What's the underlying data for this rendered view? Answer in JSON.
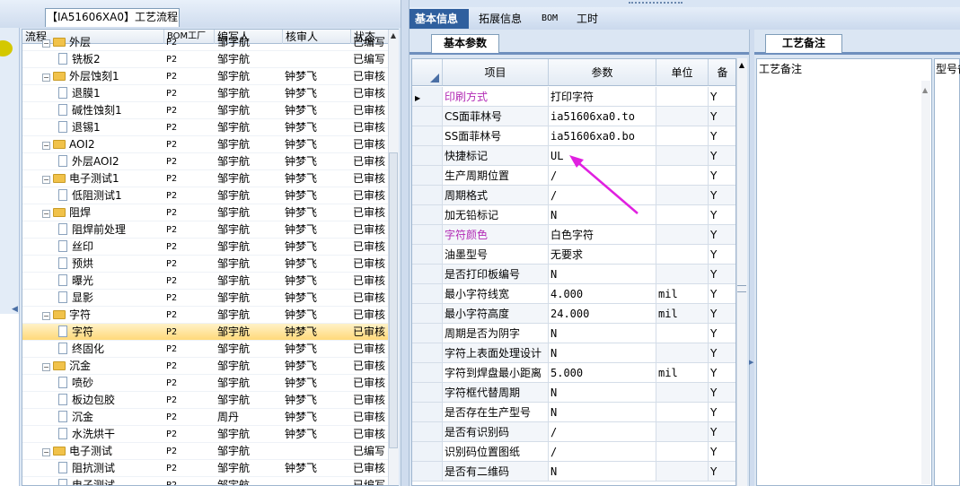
{
  "left_tab": {
    "title": "【IA51606XA0】工艺流程"
  },
  "tree": {
    "columns": [
      "流程",
      "BOM工厂",
      "编写人",
      "核审人",
      "状态"
    ],
    "rows": [
      {
        "level": 1,
        "type": "folder",
        "name": "外层",
        "factory": "P2",
        "writer": "邹宇航",
        "reviewer": "",
        "status": "已编写"
      },
      {
        "level": 2,
        "type": "doc",
        "name": "铣板2",
        "factory": "P2",
        "writer": "邹宇航",
        "reviewer": "",
        "status": "已编写"
      },
      {
        "level": 1,
        "type": "folder",
        "name": "外层蚀刻1",
        "factory": "P2",
        "writer": "邹宇航",
        "reviewer": "钟梦飞",
        "status": "已审核"
      },
      {
        "level": 2,
        "type": "doc",
        "name": "退膜1",
        "factory": "P2",
        "writer": "邹宇航",
        "reviewer": "钟梦飞",
        "status": "已审核"
      },
      {
        "level": 2,
        "type": "doc",
        "name": "碱性蚀刻1",
        "factory": "P2",
        "writer": "邹宇航",
        "reviewer": "钟梦飞",
        "status": "已审核"
      },
      {
        "level": 2,
        "type": "doc",
        "name": "退锡1",
        "factory": "P2",
        "writer": "邹宇航",
        "reviewer": "钟梦飞",
        "status": "已审核"
      },
      {
        "level": 1,
        "type": "folder",
        "name": "AOI2",
        "factory": "P2",
        "writer": "邹宇航",
        "reviewer": "钟梦飞",
        "status": "已审核"
      },
      {
        "level": 2,
        "type": "doc",
        "name": "外层AOI2",
        "factory": "P2",
        "writer": "邹宇航",
        "reviewer": "钟梦飞",
        "status": "已审核"
      },
      {
        "level": 1,
        "type": "folder",
        "name": "电子测试1",
        "factory": "P2",
        "writer": "邹宇航",
        "reviewer": "钟梦飞",
        "status": "已审核"
      },
      {
        "level": 2,
        "type": "doc",
        "name": "低阻测试1",
        "factory": "P2",
        "writer": "邹宇航",
        "reviewer": "钟梦飞",
        "status": "已审核"
      },
      {
        "level": 1,
        "type": "folder",
        "name": "阻焊",
        "factory": "P2",
        "writer": "邹宇航",
        "reviewer": "钟梦飞",
        "status": "已审核"
      },
      {
        "level": 2,
        "type": "doc",
        "name": "阻焊前处理",
        "factory": "P2",
        "writer": "邹宇航",
        "reviewer": "钟梦飞",
        "status": "已审核"
      },
      {
        "level": 2,
        "type": "doc",
        "name": "丝印",
        "factory": "P2",
        "writer": "邹宇航",
        "reviewer": "钟梦飞",
        "status": "已审核"
      },
      {
        "level": 2,
        "type": "doc",
        "name": "预烘",
        "factory": "P2",
        "writer": "邹宇航",
        "reviewer": "钟梦飞",
        "status": "已审核"
      },
      {
        "level": 2,
        "type": "doc",
        "name": "曝光",
        "factory": "P2",
        "writer": "邹宇航",
        "reviewer": "钟梦飞",
        "status": "已审核"
      },
      {
        "level": 2,
        "type": "doc",
        "name": "显影",
        "factory": "P2",
        "writer": "邹宇航",
        "reviewer": "钟梦飞",
        "status": "已审核"
      },
      {
        "level": 1,
        "type": "folder",
        "name": "字符",
        "factory": "P2",
        "writer": "邹宇航",
        "reviewer": "钟梦飞",
        "status": "已审核"
      },
      {
        "level": 2,
        "type": "doc",
        "name": "字符",
        "factory": "P2",
        "writer": "邹宇航",
        "reviewer": "钟梦飞",
        "status": "已审核",
        "selected": true
      },
      {
        "level": 2,
        "type": "doc",
        "name": "终固化",
        "factory": "P2",
        "writer": "邹宇航",
        "reviewer": "钟梦飞",
        "status": "已审核"
      },
      {
        "level": 1,
        "type": "folder",
        "name": "沉金",
        "factory": "P2",
        "writer": "邹宇航",
        "reviewer": "钟梦飞",
        "status": "已审核"
      },
      {
        "level": 2,
        "type": "doc",
        "name": "喷砂",
        "factory": "P2",
        "writer": "邹宇航",
        "reviewer": "钟梦飞",
        "status": "已审核"
      },
      {
        "level": 2,
        "type": "doc",
        "name": "板边包胶",
        "factory": "P2",
        "writer": "邹宇航",
        "reviewer": "钟梦飞",
        "status": "已审核"
      },
      {
        "level": 2,
        "type": "doc",
        "name": "沉金",
        "factory": "P2",
        "writer": "周丹",
        "reviewer": "钟梦飞",
        "status": "已审核"
      },
      {
        "level": 2,
        "type": "doc",
        "name": "水洗烘干",
        "factory": "P2",
        "writer": "邹宇航",
        "reviewer": "钟梦飞",
        "status": "已审核"
      },
      {
        "level": 1,
        "type": "folder",
        "name": "电子测试",
        "factory": "P2",
        "writer": "邹宇航",
        "reviewer": "",
        "status": "已编写"
      },
      {
        "level": 2,
        "type": "doc",
        "name": "阻抗测试",
        "factory": "P2",
        "writer": "邹宇航",
        "reviewer": "钟梦飞",
        "status": "已审核"
      },
      {
        "level": 2,
        "type": "doc",
        "name": "电子测试",
        "factory": "P2",
        "writer": "邹宇航",
        "reviewer": "",
        "status": "已编写"
      }
    ]
  },
  "main_tabs": [
    "基本信息",
    "拓展信息",
    "BOM",
    "工时"
  ],
  "params_panel": {
    "tab": "基本参数",
    "columns": [
      "项目",
      "参数",
      "单位",
      "备"
    ],
    "rows": [
      {
        "item": "印刷方式",
        "value": "打印字符",
        "unit": "",
        "flag": "Y",
        "highlight": true,
        "current": true
      },
      {
        "item": "CS面菲林号",
        "value": "ia51606xa0.to",
        "unit": "",
        "flag": "Y"
      },
      {
        "item": "SS面菲林号",
        "value": "ia51606xa0.bo",
        "unit": "",
        "flag": "Y"
      },
      {
        "item": "快捷标记",
        "value": "UL",
        "unit": "",
        "flag": "Y"
      },
      {
        "item": "生产周期位置",
        "value": "/",
        "unit": "",
        "flag": "Y"
      },
      {
        "item": "周期格式",
        "value": "/",
        "unit": "",
        "flag": "Y"
      },
      {
        "item": "加无铅标记",
        "value": "N",
        "unit": "",
        "flag": "Y"
      },
      {
        "item": "字符颜色",
        "value": "白色字符",
        "unit": "",
        "flag": "Y",
        "highlight": true
      },
      {
        "item": "油墨型号",
        "value": "无要求",
        "unit": "",
        "flag": "Y"
      },
      {
        "item": "是否打印板编号",
        "value": "N",
        "unit": "",
        "flag": "Y"
      },
      {
        "item": "最小字符线宽",
        "value": "4.000",
        "unit": "mil",
        "flag": "Y"
      },
      {
        "item": "最小字符高度",
        "value": "24.000",
        "unit": "mil",
        "flag": "Y"
      },
      {
        "item": "周期是否为阴字",
        "value": "N",
        "unit": "",
        "flag": "Y"
      },
      {
        "item": "字符上表面处理设计",
        "value": "N",
        "unit": "",
        "flag": "Y"
      },
      {
        "item": "字符到焊盘最小距离",
        "value": "5.000",
        "unit": "mil",
        "flag": "Y"
      },
      {
        "item": "字符框代替周期",
        "value": "N",
        "unit": "",
        "flag": "Y"
      },
      {
        "item": "是否存在生产型号",
        "value": "N",
        "unit": "",
        "flag": "Y"
      },
      {
        "item": "是否有识别码",
        "value": "/",
        "unit": "",
        "flag": "Y"
      },
      {
        "item": "识别码位置图纸",
        "value": "/",
        "unit": "",
        "flag": "Y"
      },
      {
        "item": "是否有二维码",
        "value": "N",
        "unit": "",
        "flag": "Y"
      }
    ]
  },
  "remarks_panel": {
    "tab": "工艺备注",
    "label": "工艺备注",
    "label2": "型号备"
  },
  "colors": {
    "accent": "#2f5f9e",
    "highlight_text": "#b22ab5",
    "selected_row": "#ffd97a",
    "arrow": "#e020e0"
  }
}
